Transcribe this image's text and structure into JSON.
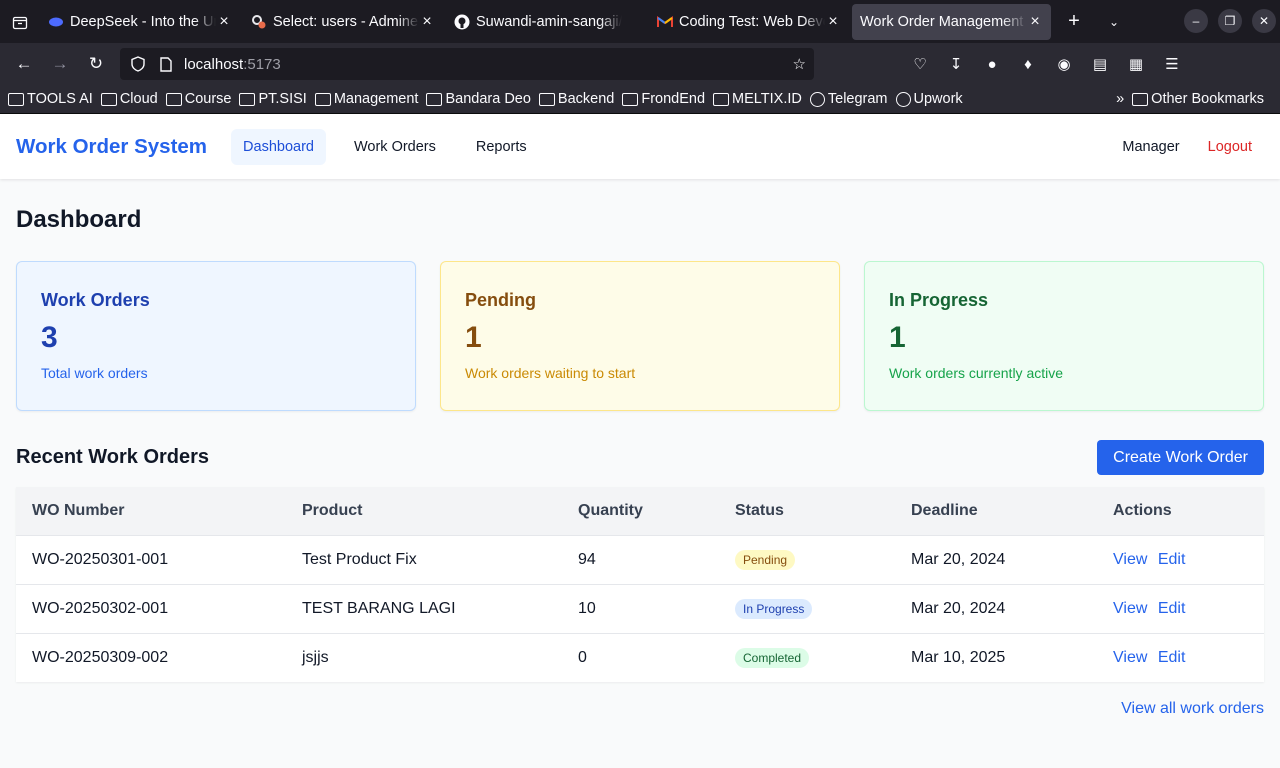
{
  "browser": {
    "tabs": [
      {
        "title": "DeepSeek - Into the Unknown",
        "icon": "deepseek-icon",
        "active": false
      },
      {
        "title": "Select: users - Adminer",
        "icon": "adminer-icon",
        "active": false
      },
      {
        "title": "Suwandi-amin-sangaji/",
        "icon": "github-icon",
        "active": false
      },
      {
        "title": "Coding Test: Web Developer",
        "icon": "gmail-icon",
        "active": false
      },
      {
        "title": "Work Order Management",
        "icon": "",
        "active": true
      }
    ],
    "url_host": "localhost",
    "url_port": ":5173",
    "bookmarks": [
      {
        "label": "TOOLS AI",
        "type": "folder"
      },
      {
        "label": "Cloud",
        "type": "folder"
      },
      {
        "label": "Course",
        "type": "folder"
      },
      {
        "label": "PT.SISI",
        "type": "folder"
      },
      {
        "label": "Management",
        "type": "folder"
      },
      {
        "label": "Bandara Deo",
        "type": "folder"
      },
      {
        "label": "Backend",
        "type": "folder"
      },
      {
        "label": "FrondEnd",
        "type": "folder"
      },
      {
        "label": "MELTIX.ID",
        "type": "folder"
      },
      {
        "label": "Telegram",
        "type": "globe"
      },
      {
        "label": "Upwork",
        "type": "globe"
      }
    ],
    "other_bookmarks": "Other Bookmarks"
  },
  "app": {
    "brand": "Work Order System",
    "nav": [
      "Dashboard",
      "Work Orders",
      "Reports"
    ],
    "user": "Manager",
    "logout": "Logout"
  },
  "page": {
    "title": "Dashboard",
    "cards": [
      {
        "title": "Work Orders",
        "value": "3",
        "desc": "Total work orders"
      },
      {
        "title": "Pending",
        "value": "1",
        "desc": "Work orders waiting to start"
      },
      {
        "title": "In Progress",
        "value": "1",
        "desc": "Work orders currently active"
      }
    ],
    "recent_title": "Recent Work Orders",
    "create_label": "Create Work Order",
    "columns": [
      "WO Number",
      "Product",
      "Quantity",
      "Status",
      "Deadline",
      "Actions"
    ],
    "rows": [
      {
        "wo": "WO-20250301-001",
        "product": "Test Product Fix",
        "qty": "94",
        "status": "Pending",
        "deadline": "Mar 20, 2024"
      },
      {
        "wo": "WO-20250302-001",
        "product": "TEST BARANG LAGI",
        "qty": "10",
        "status": "In Progress",
        "deadline": "Mar 20, 2024"
      },
      {
        "wo": "WO-20250309-002",
        "product": "jsjjs",
        "qty": "0",
        "status": "Completed",
        "deadline": "Mar 10, 2025"
      }
    ],
    "view_label": "View",
    "edit_label": "Edit",
    "view_all": "View all work orders"
  },
  "colors": {
    "brand": "#2563eb",
    "logout": "#dc2626"
  }
}
